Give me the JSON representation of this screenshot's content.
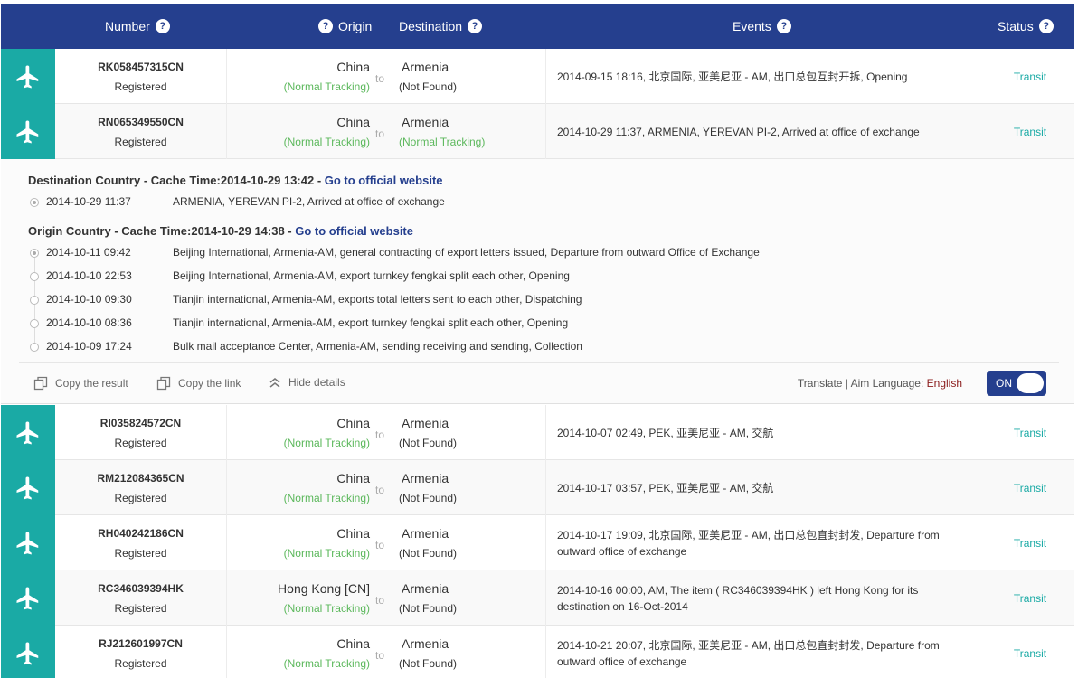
{
  "header": {
    "number": "Number",
    "origin": "Origin",
    "destination": "Destination",
    "events": "Events",
    "status": "Status",
    "help_glyph": "?"
  },
  "to_label": "to",
  "rows_top": [
    {
      "number": "RK058457315CN",
      "state": "Registered",
      "origin": "China",
      "origin_track": "(Normal Tracking)",
      "dest": "Armenia",
      "dest_track": "(Not Found)",
      "event": "2014-09-15 18:16, 北京国际, 亚美尼亚 - AM, 出口总包互封开拆, Opening",
      "status": "Transit"
    },
    {
      "number": "RN065349550CN",
      "state": "Registered",
      "origin": "China",
      "origin_track": "(Normal Tracking)",
      "dest": "Armenia",
      "dest_track": "(Normal Tracking)",
      "event": "2014-10-29 11:37, ARMENIA, YEREVAN PI-2, Arrived at office of exchange",
      "status": "Transit"
    }
  ],
  "details": {
    "dest_title": "Destination Country - Cache Time:2014-10-29 13:42 - ",
    "dest_link": "Go to official website",
    "dest_events": [
      {
        "date": "2014-10-29 11:37",
        "desc": "ARMENIA, YEREVAN PI-2, Arrived at office of exchange"
      }
    ],
    "origin_title": "Origin Country - Cache Time:2014-10-29 14:38 - ",
    "origin_link": "Go to official website",
    "origin_events": [
      {
        "date": "2014-10-11 09:42",
        "desc": "Beijing International, Armenia-AM, general contracting of export letters issued, Departure from outward Office of Exchange"
      },
      {
        "date": "2014-10-10 22:53",
        "desc": "Beijing International, Armenia-AM, export turnkey fengkai split each other, Opening"
      },
      {
        "date": "2014-10-10 09:30",
        "desc": "Tianjin international, Armenia-AM, exports total letters sent to each other, Dispatching"
      },
      {
        "date": "2014-10-10 08:36",
        "desc": "Tianjin international, Armenia-AM, export turnkey fengkai split each other, Opening"
      },
      {
        "date": "2014-10-09 17:24",
        "desc": "Bulk mail acceptance Center, Armenia-AM, sending receiving and sending, Collection"
      }
    ],
    "copy_result": "Copy the result",
    "copy_link": "Copy the link",
    "hide_details": "Hide details",
    "translate_label": "Translate | Aim Language: ",
    "language": "English",
    "toggle_label": "ON"
  },
  "rows_bottom": [
    {
      "number": "RI035824572CN",
      "state": "Registered",
      "origin": "China",
      "origin_track": "(Normal Tracking)",
      "dest": "Armenia",
      "dest_track": "(Not Found)",
      "event": "2014-10-07 02:49, PEK, 亚美尼亚 - AM, 交航",
      "status": "Transit"
    },
    {
      "number": "RM212084365CN",
      "state": "Registered",
      "origin": "China",
      "origin_track": "(Normal Tracking)",
      "dest": "Armenia",
      "dest_track": "(Not Found)",
      "event": "2014-10-17 03:57, PEK, 亚美尼亚 - AM, 交航",
      "status": "Transit"
    },
    {
      "number": "RH040242186CN",
      "state": "Registered",
      "origin": "China",
      "origin_track": "(Normal Tracking)",
      "dest": "Armenia",
      "dest_track": "(Not Found)",
      "event": "2014-10-17 19:09, 北京国际, 亚美尼亚 - AM, 出口总包直封封发, Departure from outward office of exchange",
      "status": "Transit"
    },
    {
      "number": "RC346039394HK",
      "state": "Registered",
      "origin": "Hong Kong [CN]",
      "origin_track": "(Normal Tracking)",
      "dest": "Armenia",
      "dest_track": "(Not Found)",
      "event": "2014-10-16 00:00, AM, The item ( RC346039394HK ) left Hong Kong for its destination on 16-Oct-2014",
      "status": "Transit"
    },
    {
      "number": "RJ212601997CN",
      "state": "Registered",
      "origin": "China",
      "origin_track": "(Normal Tracking)",
      "dest": "Armenia",
      "dest_track": "(Not Found)",
      "event": "2014-10-21 20:07, 北京国际, 亚美尼亚 - AM, 出口总包直封封发, Departure from outward office of exchange",
      "status": "Transit"
    }
  ],
  "colors": {
    "header": "#253f8e",
    "plane_tile": "#1aaaa5",
    "normal_tracking": "#5cb85c",
    "status": "#1aaaa5",
    "language": "#8b1c1c"
  }
}
